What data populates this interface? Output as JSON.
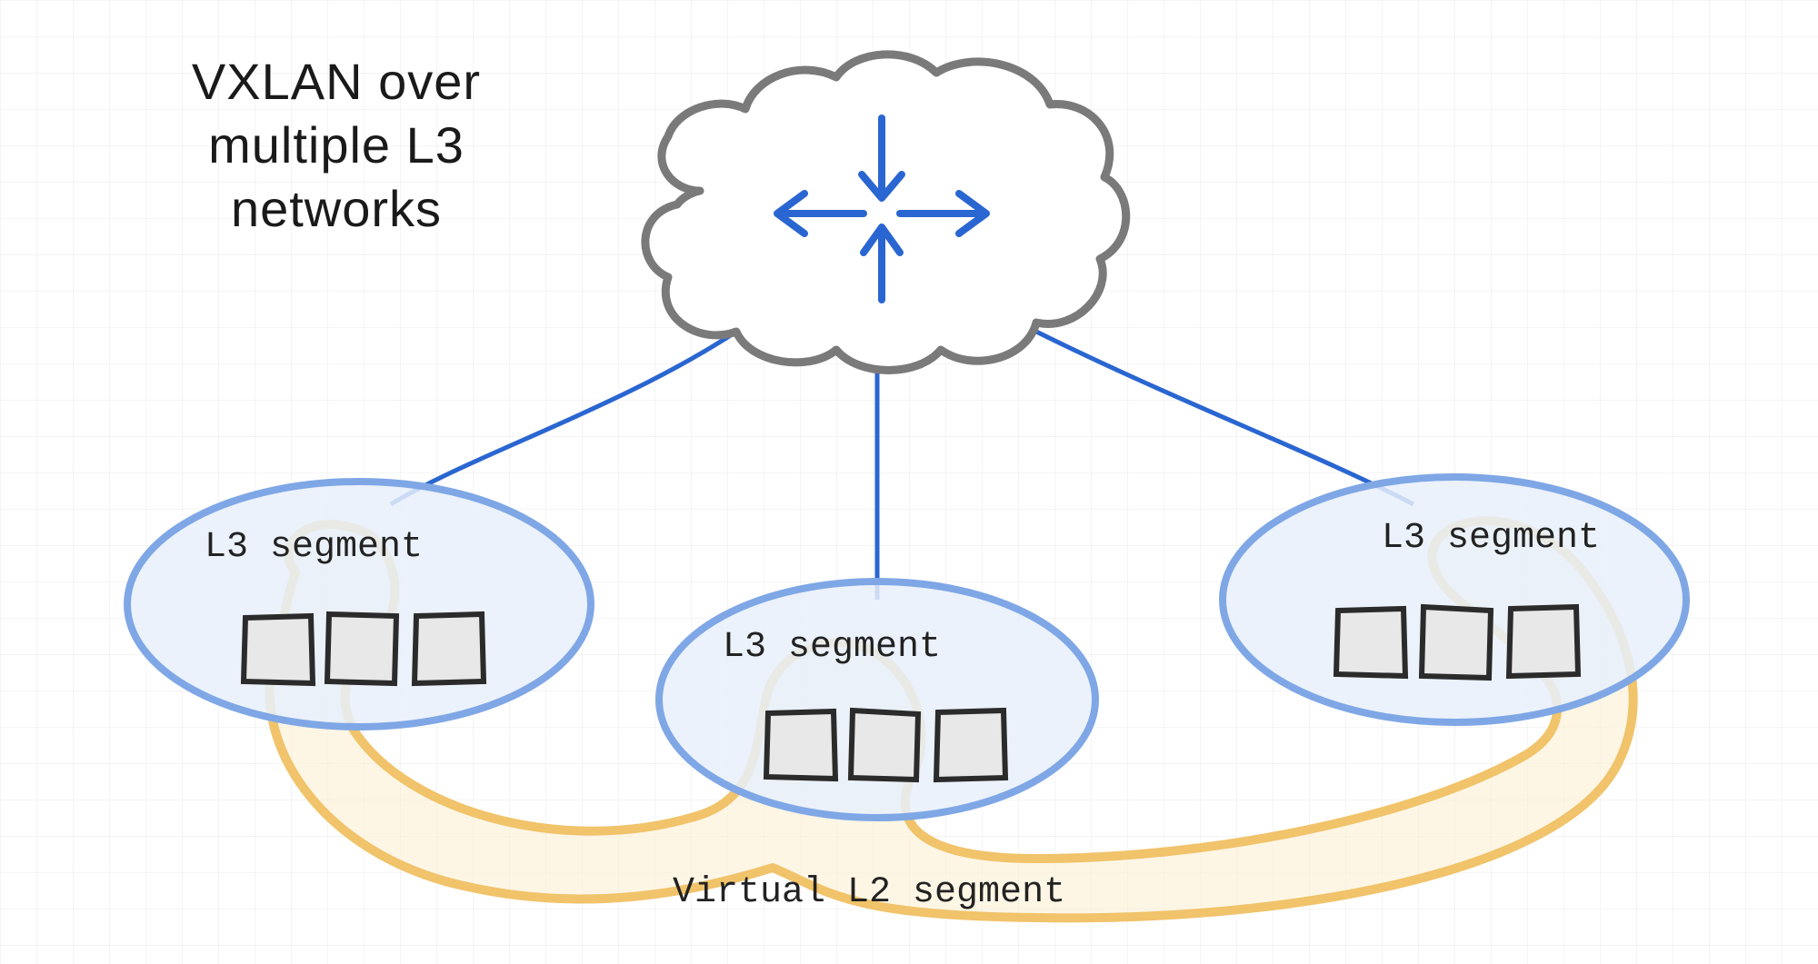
{
  "title_line1": "VXLAN over",
  "title_line2": "multiple L3",
  "title_line3": "networks",
  "segments": {
    "left": {
      "label": "L3 segment"
    },
    "middle": {
      "label": "L3 segment"
    },
    "right": {
      "label": "L3 segment"
    }
  },
  "virtual_segment_label": "Virtual L2 segment",
  "colors": {
    "cloud_stroke": "#7a7a7a",
    "segment_stroke": "#7fa7e6",
    "segment_fill": "#e8f0fb",
    "link_stroke": "#2a66d1",
    "arrow_stroke": "#2a66d1",
    "virtual_stroke": "#f1c36a",
    "virtual_fill": "#fbefcf",
    "node_stroke": "#2b2b2b",
    "node_fill": "#e8e8e8"
  }
}
